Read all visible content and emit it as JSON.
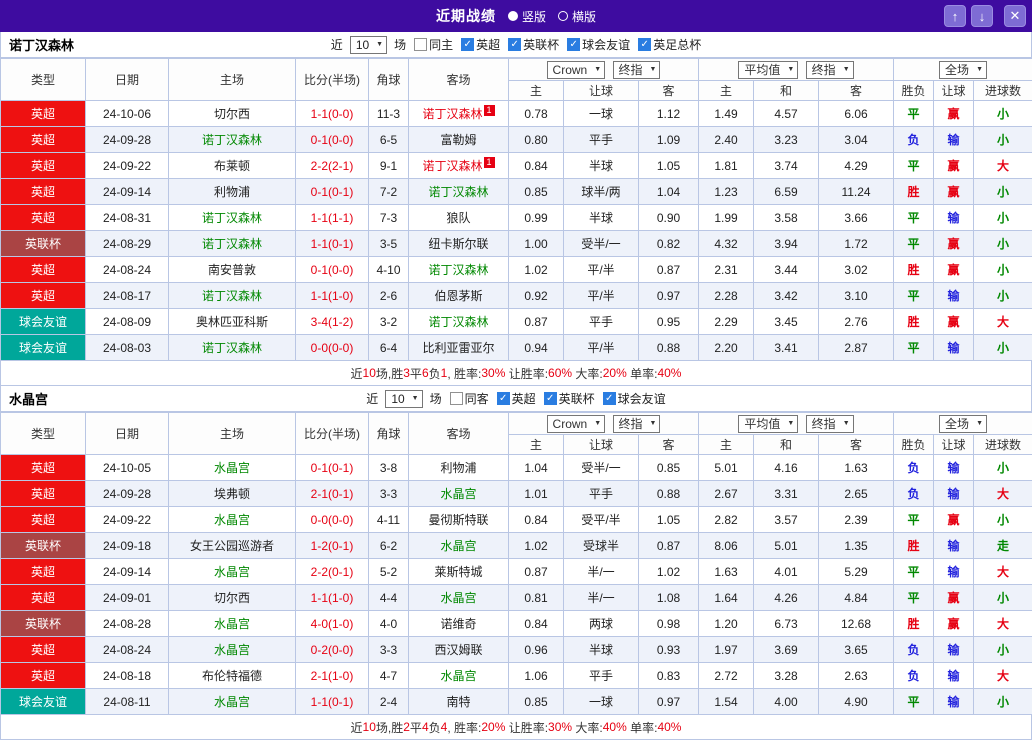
{
  "header": {
    "title": "近期战绩",
    "view_options": [
      {
        "label": "竖版",
        "selected": true
      },
      {
        "label": "横版",
        "selected": false
      }
    ],
    "window_buttons": {
      "up": "↑",
      "down": "↓",
      "close": "✕"
    }
  },
  "filter_labels": {
    "near": "近",
    "count": "10",
    "games": "场"
  },
  "columns": {
    "type": "类型",
    "date": "日期",
    "home": "主场",
    "score": "比分(半场)",
    "corner": "角球",
    "away": "客场",
    "sub": [
      "主",
      "让球",
      "客",
      "主",
      "和",
      "客",
      "胜负",
      "让球",
      "进球数"
    ],
    "selects": {
      "bookmaker": "Crown",
      "final1": "终指",
      "average": "平均值",
      "final2": "终指",
      "scope": "全场"
    }
  },
  "colors": {
    "league_bg": {
      "英超": "#ee1111",
      "英联杯": "#aa4444",
      "球会友谊": "#00a79a"
    },
    "name_color": {
      "plain": "#222222",
      "focal": "#008800",
      "sentoff": "#e60012"
    },
    "result_color": {
      "胜": "#e60012",
      "负": "#2222dd",
      "平": "#008800",
      "赢": "#e60012",
      "输": "#2222dd",
      "走": "#008800",
      "大": "#e60012",
      "小": "#008800"
    },
    "score": "#e60012"
  },
  "sections": [
    {
      "team": "诺丁汉森林",
      "same_filter": {
        "label": "同主",
        "checked": false
      },
      "leagues": [
        {
          "label": "英超",
          "checked": true
        },
        {
          "label": "英联杯",
          "checked": true
        },
        {
          "label": "球会友谊",
          "checked": true
        },
        {
          "label": "英足总杯",
          "checked": true
        }
      ],
      "rows": [
        {
          "league": "英超",
          "date": "24-10-06",
          "home": {
            "name": "切尔西",
            "style": "plain"
          },
          "score": "1-1(0-0)",
          "corner": "11-3",
          "away": {
            "name": "诺丁汉森林",
            "style": "sentoff",
            "badge": "1"
          },
          "odds": [
            "0.78",
            "一球",
            "1.12",
            "1.49",
            "4.57",
            "6.06"
          ],
          "results": [
            "平",
            "赢",
            "小"
          ]
        },
        {
          "league": "英超",
          "date": "24-09-28",
          "home": {
            "name": "诺丁汉森林",
            "style": "focal"
          },
          "score": "0-1(0-0)",
          "corner": "6-5",
          "away": {
            "name": "富勒姆",
            "style": "plain"
          },
          "odds": [
            "0.80",
            "平手",
            "1.09",
            "2.40",
            "3.23",
            "3.04"
          ],
          "results": [
            "负",
            "输",
            "小"
          ]
        },
        {
          "league": "英超",
          "date": "24-09-22",
          "home": {
            "name": "布莱顿",
            "style": "plain"
          },
          "score": "2-2(2-1)",
          "corner": "9-1",
          "away": {
            "name": "诺丁汉森林",
            "style": "sentoff",
            "badge": "1"
          },
          "odds": [
            "0.84",
            "半球",
            "1.05",
            "1.81",
            "3.74",
            "4.29"
          ],
          "results": [
            "平",
            "赢",
            "大"
          ]
        },
        {
          "league": "英超",
          "date": "24-09-14",
          "home": {
            "name": "利物浦",
            "style": "plain"
          },
          "score": "0-1(0-1)",
          "corner": "7-2",
          "away": {
            "name": "诺丁汉森林",
            "style": "focal"
          },
          "odds": [
            "0.85",
            "球半/两",
            "1.04",
            "1.23",
            "6.59",
            "11.24"
          ],
          "results": [
            "胜",
            "赢",
            "小"
          ]
        },
        {
          "league": "英超",
          "date": "24-08-31",
          "home": {
            "name": "诺丁汉森林",
            "style": "focal"
          },
          "score": "1-1(1-1)",
          "corner": "7-3",
          "away": {
            "name": "狼队",
            "style": "plain"
          },
          "odds": [
            "0.99",
            "半球",
            "0.90",
            "1.99",
            "3.58",
            "3.66"
          ],
          "results": [
            "平",
            "输",
            "小"
          ]
        },
        {
          "league": "英联杯",
          "date": "24-08-29",
          "home": {
            "name": "诺丁汉森林",
            "style": "focal"
          },
          "score": "1-1(0-1)",
          "corner": "3-5",
          "away": {
            "name": "纽卡斯尔联",
            "style": "plain"
          },
          "odds": [
            "1.00",
            "受半/一",
            "0.82",
            "4.32",
            "3.94",
            "1.72"
          ],
          "results": [
            "平",
            "赢",
            "小"
          ]
        },
        {
          "league": "英超",
          "date": "24-08-24",
          "home": {
            "name": "南安普敦",
            "style": "plain"
          },
          "score": "0-1(0-0)",
          "corner": "4-10",
          "away": {
            "name": "诺丁汉森林",
            "style": "focal"
          },
          "odds": [
            "1.02",
            "平/半",
            "0.87",
            "2.31",
            "3.44",
            "3.02"
          ],
          "results": [
            "胜",
            "赢",
            "小"
          ]
        },
        {
          "league": "英超",
          "date": "24-08-17",
          "home": {
            "name": "诺丁汉森林",
            "style": "focal"
          },
          "score": "1-1(1-0)",
          "corner": "2-6",
          "away": {
            "name": "伯恩茅斯",
            "style": "plain"
          },
          "odds": [
            "0.92",
            "平/半",
            "0.97",
            "2.28",
            "3.42",
            "3.10"
          ],
          "results": [
            "平",
            "输",
            "小"
          ]
        },
        {
          "league": "球会友谊",
          "date": "24-08-09",
          "home": {
            "name": "奥林匹亚科斯",
            "style": "plain"
          },
          "score": "3-4(1-2)",
          "corner": "3-2",
          "away": {
            "name": "诺丁汉森林",
            "style": "focal"
          },
          "odds": [
            "0.87",
            "平手",
            "0.95",
            "2.29",
            "3.45",
            "2.76"
          ],
          "results": [
            "胜",
            "赢",
            "大"
          ]
        },
        {
          "league": "球会友谊",
          "date": "24-08-03",
          "home": {
            "name": "诺丁汉森林",
            "style": "focal"
          },
          "score": "0-0(0-0)",
          "corner": "6-4",
          "away": {
            "name": "比利亚雷亚尔",
            "style": "plain"
          },
          "odds": [
            "0.94",
            "平/半",
            "0.88",
            "2.20",
            "3.41",
            "2.87"
          ],
          "results": [
            "平",
            "输",
            "小"
          ]
        }
      ],
      "summary": [
        {
          "text": "近",
          "red": false
        },
        {
          "text": "10",
          "red": true
        },
        {
          "text": "场,胜",
          "red": false
        },
        {
          "text": "3",
          "red": true
        },
        {
          "text": "平",
          "red": false
        },
        {
          "text": "6",
          "red": true
        },
        {
          "text": "负",
          "red": false
        },
        {
          "text": "1",
          "red": true
        },
        {
          "text": ", 胜率:",
          "red": false
        },
        {
          "text": "30%",
          "red": true
        },
        {
          "text": " 让胜率:",
          "red": false
        },
        {
          "text": "60%",
          "red": true
        },
        {
          "text": " 大率:",
          "red": false
        },
        {
          "text": "20%",
          "red": true
        },
        {
          "text": " 单率:",
          "red": false
        },
        {
          "text": "40%",
          "red": true
        }
      ]
    },
    {
      "team": "水晶宫",
      "same_filter": {
        "label": "同客",
        "checked": false
      },
      "leagues": [
        {
          "label": "英超",
          "checked": true
        },
        {
          "label": "英联杯",
          "checked": true
        },
        {
          "label": "球会友谊",
          "checked": true
        }
      ],
      "rows": [
        {
          "league": "英超",
          "date": "24-10-05",
          "home": {
            "name": "水晶宫",
            "style": "focal"
          },
          "score": "0-1(0-1)",
          "corner": "3-8",
          "away": {
            "name": "利物浦",
            "style": "plain"
          },
          "odds": [
            "1.04",
            "受半/一",
            "0.85",
            "5.01",
            "4.16",
            "1.63"
          ],
          "results": [
            "负",
            "输",
            "小"
          ]
        },
        {
          "league": "英超",
          "date": "24-09-28",
          "home": {
            "name": "埃弗顿",
            "style": "plain"
          },
          "score": "2-1(0-1)",
          "corner": "3-3",
          "away": {
            "name": "水晶宫",
            "style": "focal"
          },
          "odds": [
            "1.01",
            "平手",
            "0.88",
            "2.67",
            "3.31",
            "2.65"
          ],
          "results": [
            "负",
            "输",
            "大"
          ]
        },
        {
          "league": "英超",
          "date": "24-09-22",
          "home": {
            "name": "水晶宫",
            "style": "focal"
          },
          "score": "0-0(0-0)",
          "corner": "4-11",
          "away": {
            "name": "曼彻斯特联",
            "style": "plain"
          },
          "odds": [
            "0.84",
            "受平/半",
            "1.05",
            "2.82",
            "3.57",
            "2.39"
          ],
          "results": [
            "平",
            "赢",
            "小"
          ]
        },
        {
          "league": "英联杯",
          "date": "24-09-18",
          "home": {
            "name": "女王公园巡游者",
            "style": "plain"
          },
          "score": "1-2(0-1)",
          "corner": "6-2",
          "away": {
            "name": "水晶宫",
            "style": "focal"
          },
          "odds": [
            "1.02",
            "受球半",
            "0.87",
            "8.06",
            "5.01",
            "1.35"
          ],
          "results": [
            "胜",
            "输",
            "走"
          ]
        },
        {
          "league": "英超",
          "date": "24-09-14",
          "home": {
            "name": "水晶宫",
            "style": "focal"
          },
          "score": "2-2(0-1)",
          "corner": "5-2",
          "away": {
            "name": "莱斯特城",
            "style": "plain"
          },
          "odds": [
            "0.87",
            "半/一",
            "1.02",
            "1.63",
            "4.01",
            "5.29"
          ],
          "results": [
            "平",
            "输",
            "大"
          ]
        },
        {
          "league": "英超",
          "date": "24-09-01",
          "home": {
            "name": "切尔西",
            "style": "plain"
          },
          "score": "1-1(1-0)",
          "corner": "4-4",
          "away": {
            "name": "水晶宫",
            "style": "focal"
          },
          "odds": [
            "0.81",
            "半/一",
            "1.08",
            "1.64",
            "4.26",
            "4.84"
          ],
          "results": [
            "平",
            "赢",
            "小"
          ]
        },
        {
          "league": "英联杯",
          "date": "24-08-28",
          "home": {
            "name": "水晶宫",
            "style": "focal"
          },
          "score": "4-0(1-0)",
          "corner": "4-0",
          "away": {
            "name": "诺维奇",
            "style": "plain"
          },
          "odds": [
            "0.84",
            "两球",
            "0.98",
            "1.20",
            "6.73",
            "12.68"
          ],
          "results": [
            "胜",
            "赢",
            "大"
          ]
        },
        {
          "league": "英超",
          "date": "24-08-24",
          "home": {
            "name": "水晶宫",
            "style": "focal"
          },
          "score": "0-2(0-0)",
          "corner": "3-3",
          "away": {
            "name": "西汉姆联",
            "style": "plain"
          },
          "odds": [
            "0.96",
            "半球",
            "0.93",
            "1.97",
            "3.69",
            "3.65"
          ],
          "results": [
            "负",
            "输",
            "小"
          ]
        },
        {
          "league": "英超",
          "date": "24-08-18",
          "home": {
            "name": "布伦特福德",
            "style": "plain"
          },
          "score": "2-1(1-0)",
          "corner": "4-7",
          "away": {
            "name": "水晶宫",
            "style": "focal"
          },
          "odds": [
            "1.06",
            "平手",
            "0.83",
            "2.72",
            "3.28",
            "2.63"
          ],
          "results": [
            "负",
            "输",
            "大"
          ]
        },
        {
          "league": "球会友谊",
          "date": "24-08-11",
          "home": {
            "name": "水晶宫",
            "style": "focal"
          },
          "score": "1-1(0-1)",
          "corner": "2-4",
          "away": {
            "name": "南特",
            "style": "plain"
          },
          "odds": [
            "0.85",
            "一球",
            "0.97",
            "1.54",
            "4.00",
            "4.90"
          ],
          "results": [
            "平",
            "输",
            "小"
          ]
        }
      ],
      "summary": [
        {
          "text": "近",
          "red": false
        },
        {
          "text": "10",
          "red": true
        },
        {
          "text": "场,胜",
          "red": false
        },
        {
          "text": "2",
          "red": true
        },
        {
          "text": "平",
          "red": false
        },
        {
          "text": "4",
          "red": true
        },
        {
          "text": "负",
          "red": false
        },
        {
          "text": "4",
          "red": true
        },
        {
          "text": ", 胜率:",
          "red": false
        },
        {
          "text": "20%",
          "red": true
        },
        {
          "text": " 让胜率:",
          "red": false
        },
        {
          "text": "30%",
          "red": true
        },
        {
          "text": " 大率:",
          "red": false
        },
        {
          "text": "40%",
          "red": true
        },
        {
          "text": " 单率:",
          "red": false
        },
        {
          "text": "40%",
          "red": true
        }
      ]
    }
  ]
}
